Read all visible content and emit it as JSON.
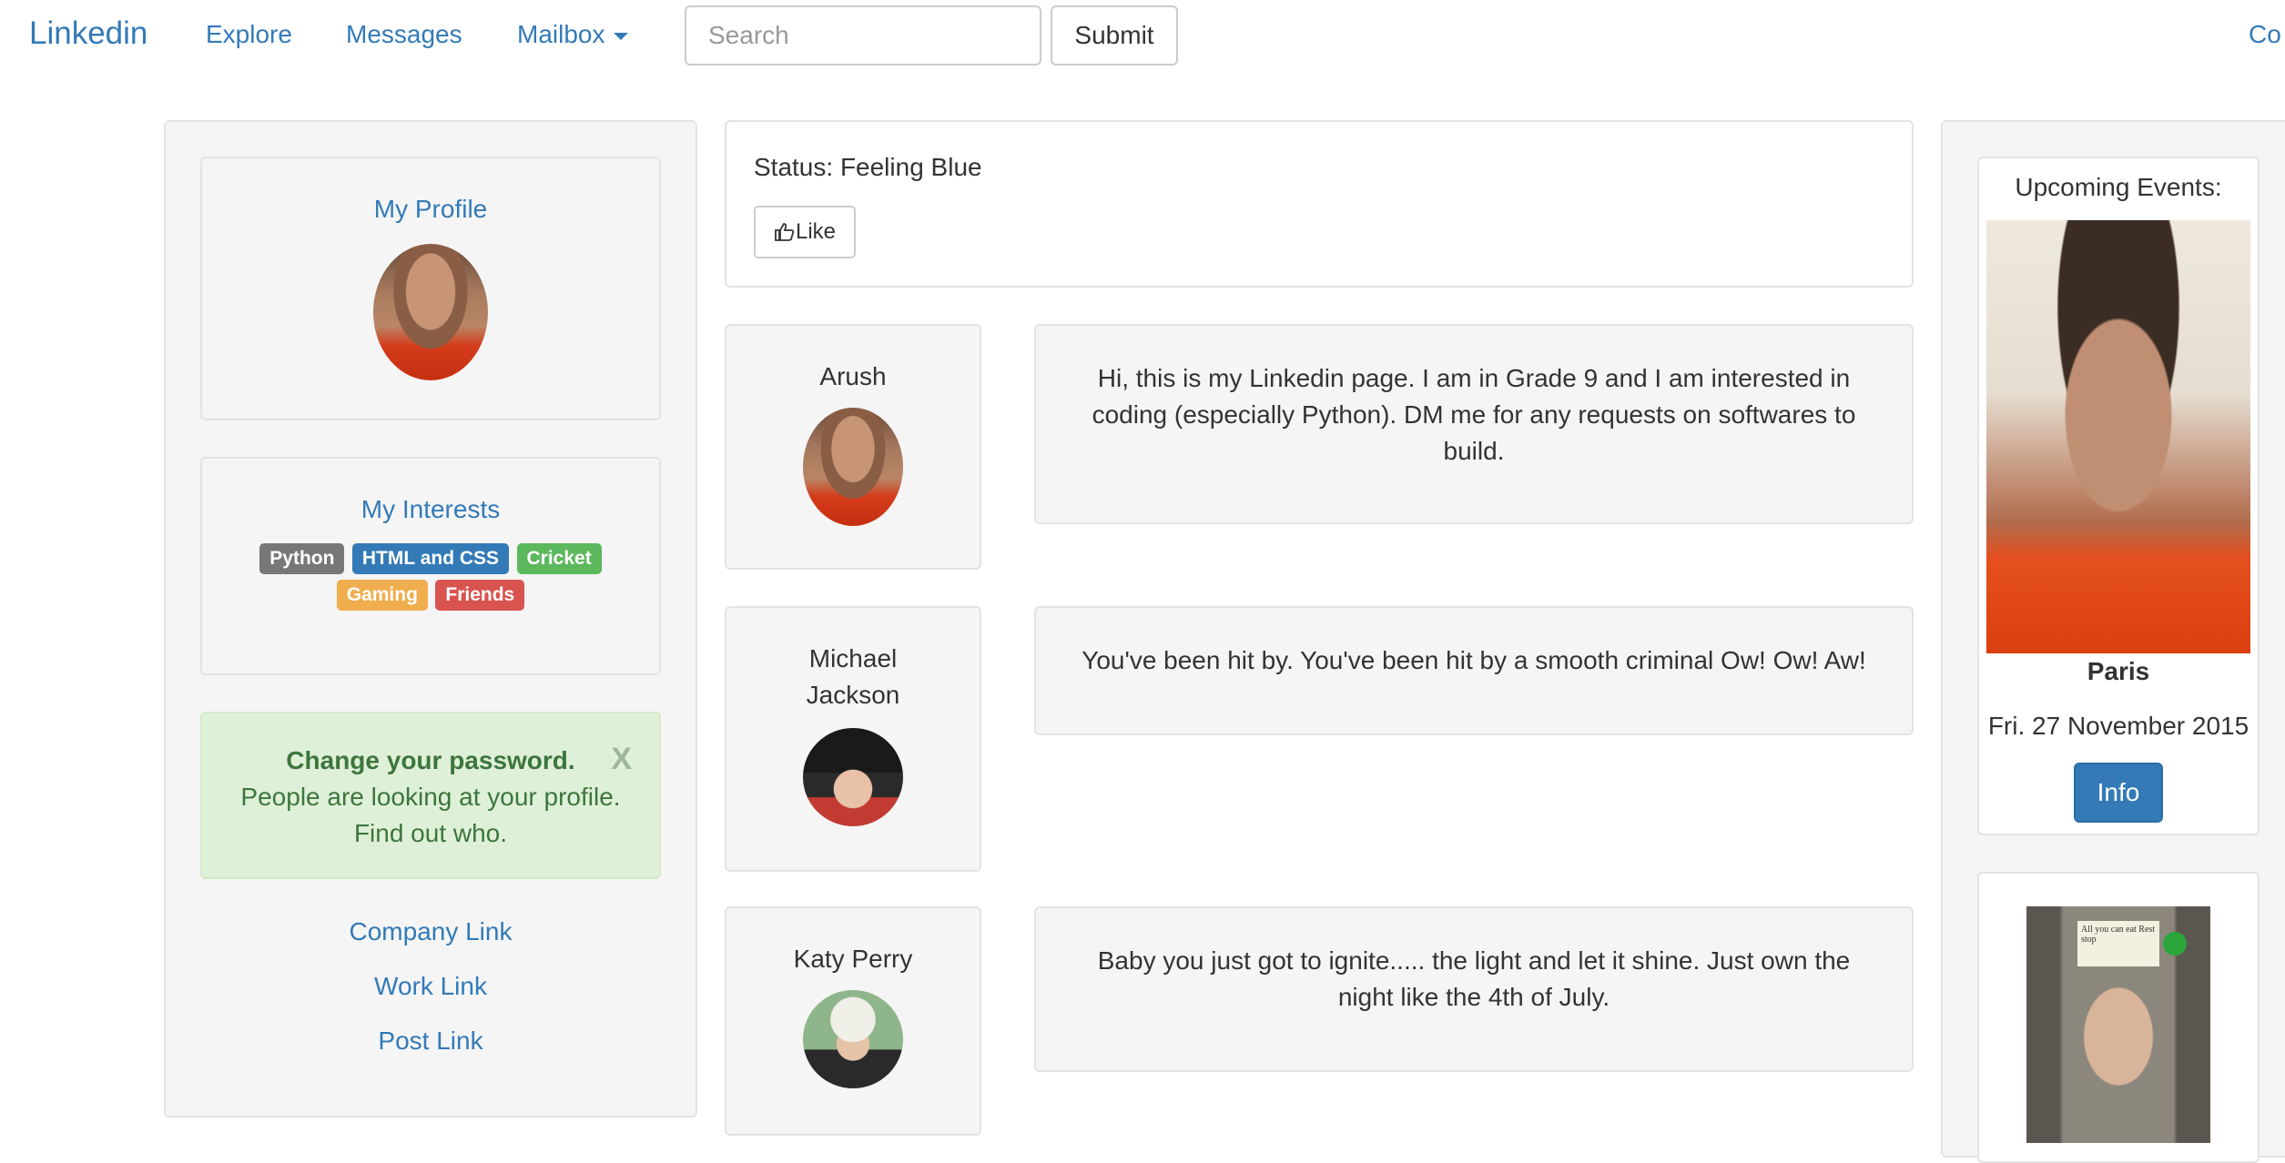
{
  "nav": {
    "brand": "Linkedin",
    "links": [
      "Explore",
      "Messages",
      "Mailbox"
    ],
    "search_placeholder": "Search",
    "submit_label": "Submit",
    "cut_off_link": "Co"
  },
  "sidebar": {
    "profile_title": "My Profile",
    "interests_title": "My Interests",
    "interests": [
      {
        "label": "Python",
        "color": "#777777"
      },
      {
        "label": "HTML and CSS",
        "color": "#337ab7"
      },
      {
        "label": "Cricket",
        "color": "#5cb85c"
      },
      {
        "label": "Gaming",
        "color": "#f0ad4e"
      },
      {
        "label": "Friends",
        "color": "#d9534f"
      }
    ],
    "alert": {
      "strong": "Change your password.",
      "text": "People are looking at your profile. Find out who.",
      "close": "X"
    },
    "links": [
      "Company Link",
      "Work Link",
      "Post Link"
    ]
  },
  "status": {
    "text": "Status: Feeling Blue",
    "like_label": "Like"
  },
  "feed": [
    {
      "name": "Arush",
      "avatar": "arush-avatar",
      "post": "Hi, this is my Linkedin page. I am in Grade 9 and I am interested in coding (especially Python). DM me for any requests on softwares to build."
    },
    {
      "name": "Michael Jackson",
      "avatar": "michael-jackson-avatar",
      "post": "You've been hit by. You've been hit by a smooth criminal Ow! Ow! Aw!"
    },
    {
      "name": "Katy Perry",
      "avatar": "katy-perry-avatar",
      "post": "Baby you just got to ignite..... the light and let it shine. Just own the night like the 4th of July."
    }
  ],
  "events": {
    "title": "Upcoming Events:",
    "city": "Paris",
    "date": "Fri. 27 November 2015",
    "info_label": "Info"
  },
  "ad": {
    "sign_text": "All you can eat Rest stop"
  }
}
